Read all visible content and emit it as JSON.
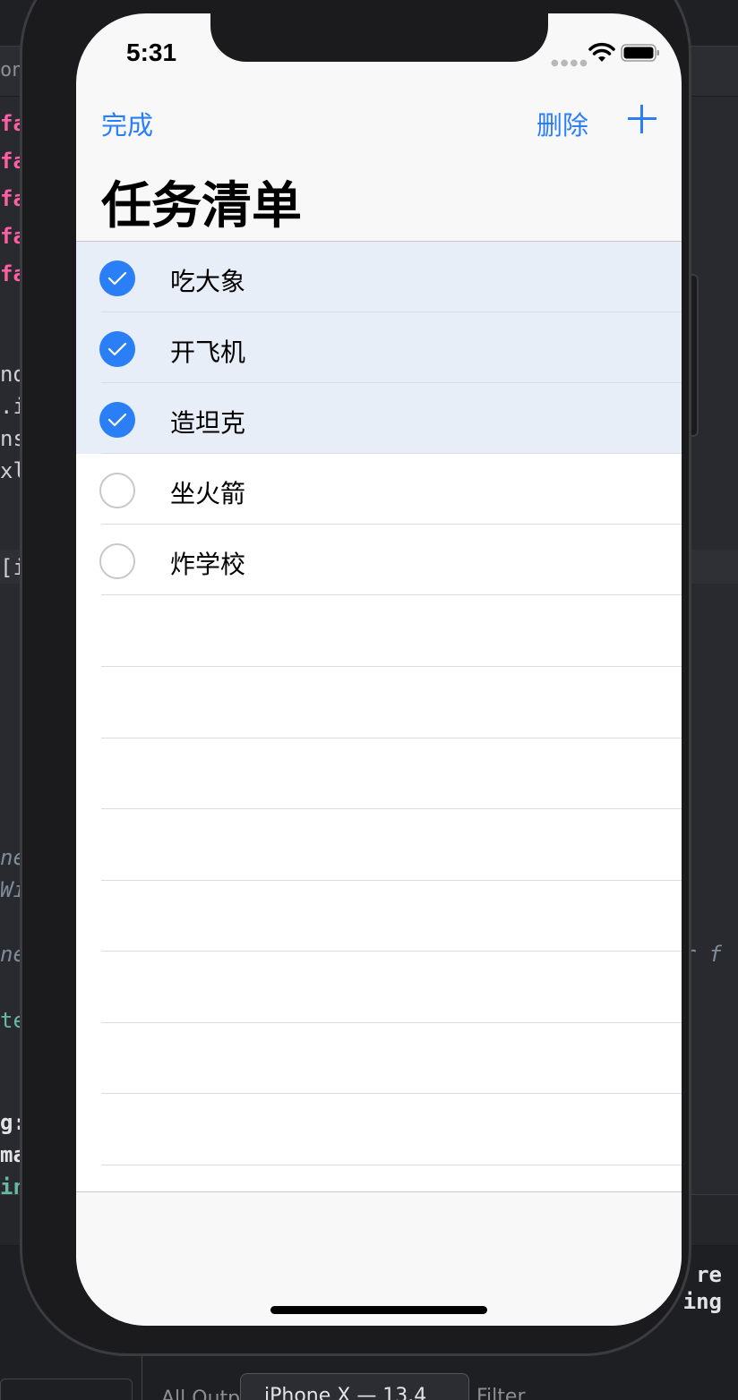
{
  "status_bar": {
    "time": "5:31",
    "signal_icon": "signal-dots-icon",
    "wifi_icon": "wifi-icon",
    "battery_icon": "battery-icon"
  },
  "nav": {
    "done_label": "完成",
    "delete_label": "删除",
    "add_icon": "plus-icon",
    "title": "任务清单"
  },
  "tasks": [
    {
      "label": "吃大象",
      "checked": true
    },
    {
      "label": "开飞机",
      "checked": true
    },
    {
      "label": "造坦克",
      "checked": true
    },
    {
      "label": "坐火箭",
      "checked": false
    },
    {
      "label": "炸学校",
      "checked": false
    }
  ],
  "colors": {
    "accent": "#2b7ff6",
    "selected_row": "#e7eef8"
  },
  "background_ide": {
    "jump_text": "on",
    "left_code": [
      "fa",
      "fa",
      "fa",
      "fa",
      "fa",
      "nd",
      ".i",
      "ns",
      "xl",
      "[i",
      "ne",
      "Wi",
      "ne",
      "te",
      "g:",
      "ma",
      "in"
    ],
    "right_code": [
      "ar f"
    ],
    "console": [
      "re",
      "ing"
    ],
    "bottom_left": "All Outpu",
    "device": "iPhone X — 13.4",
    "filter": "Filter"
  }
}
